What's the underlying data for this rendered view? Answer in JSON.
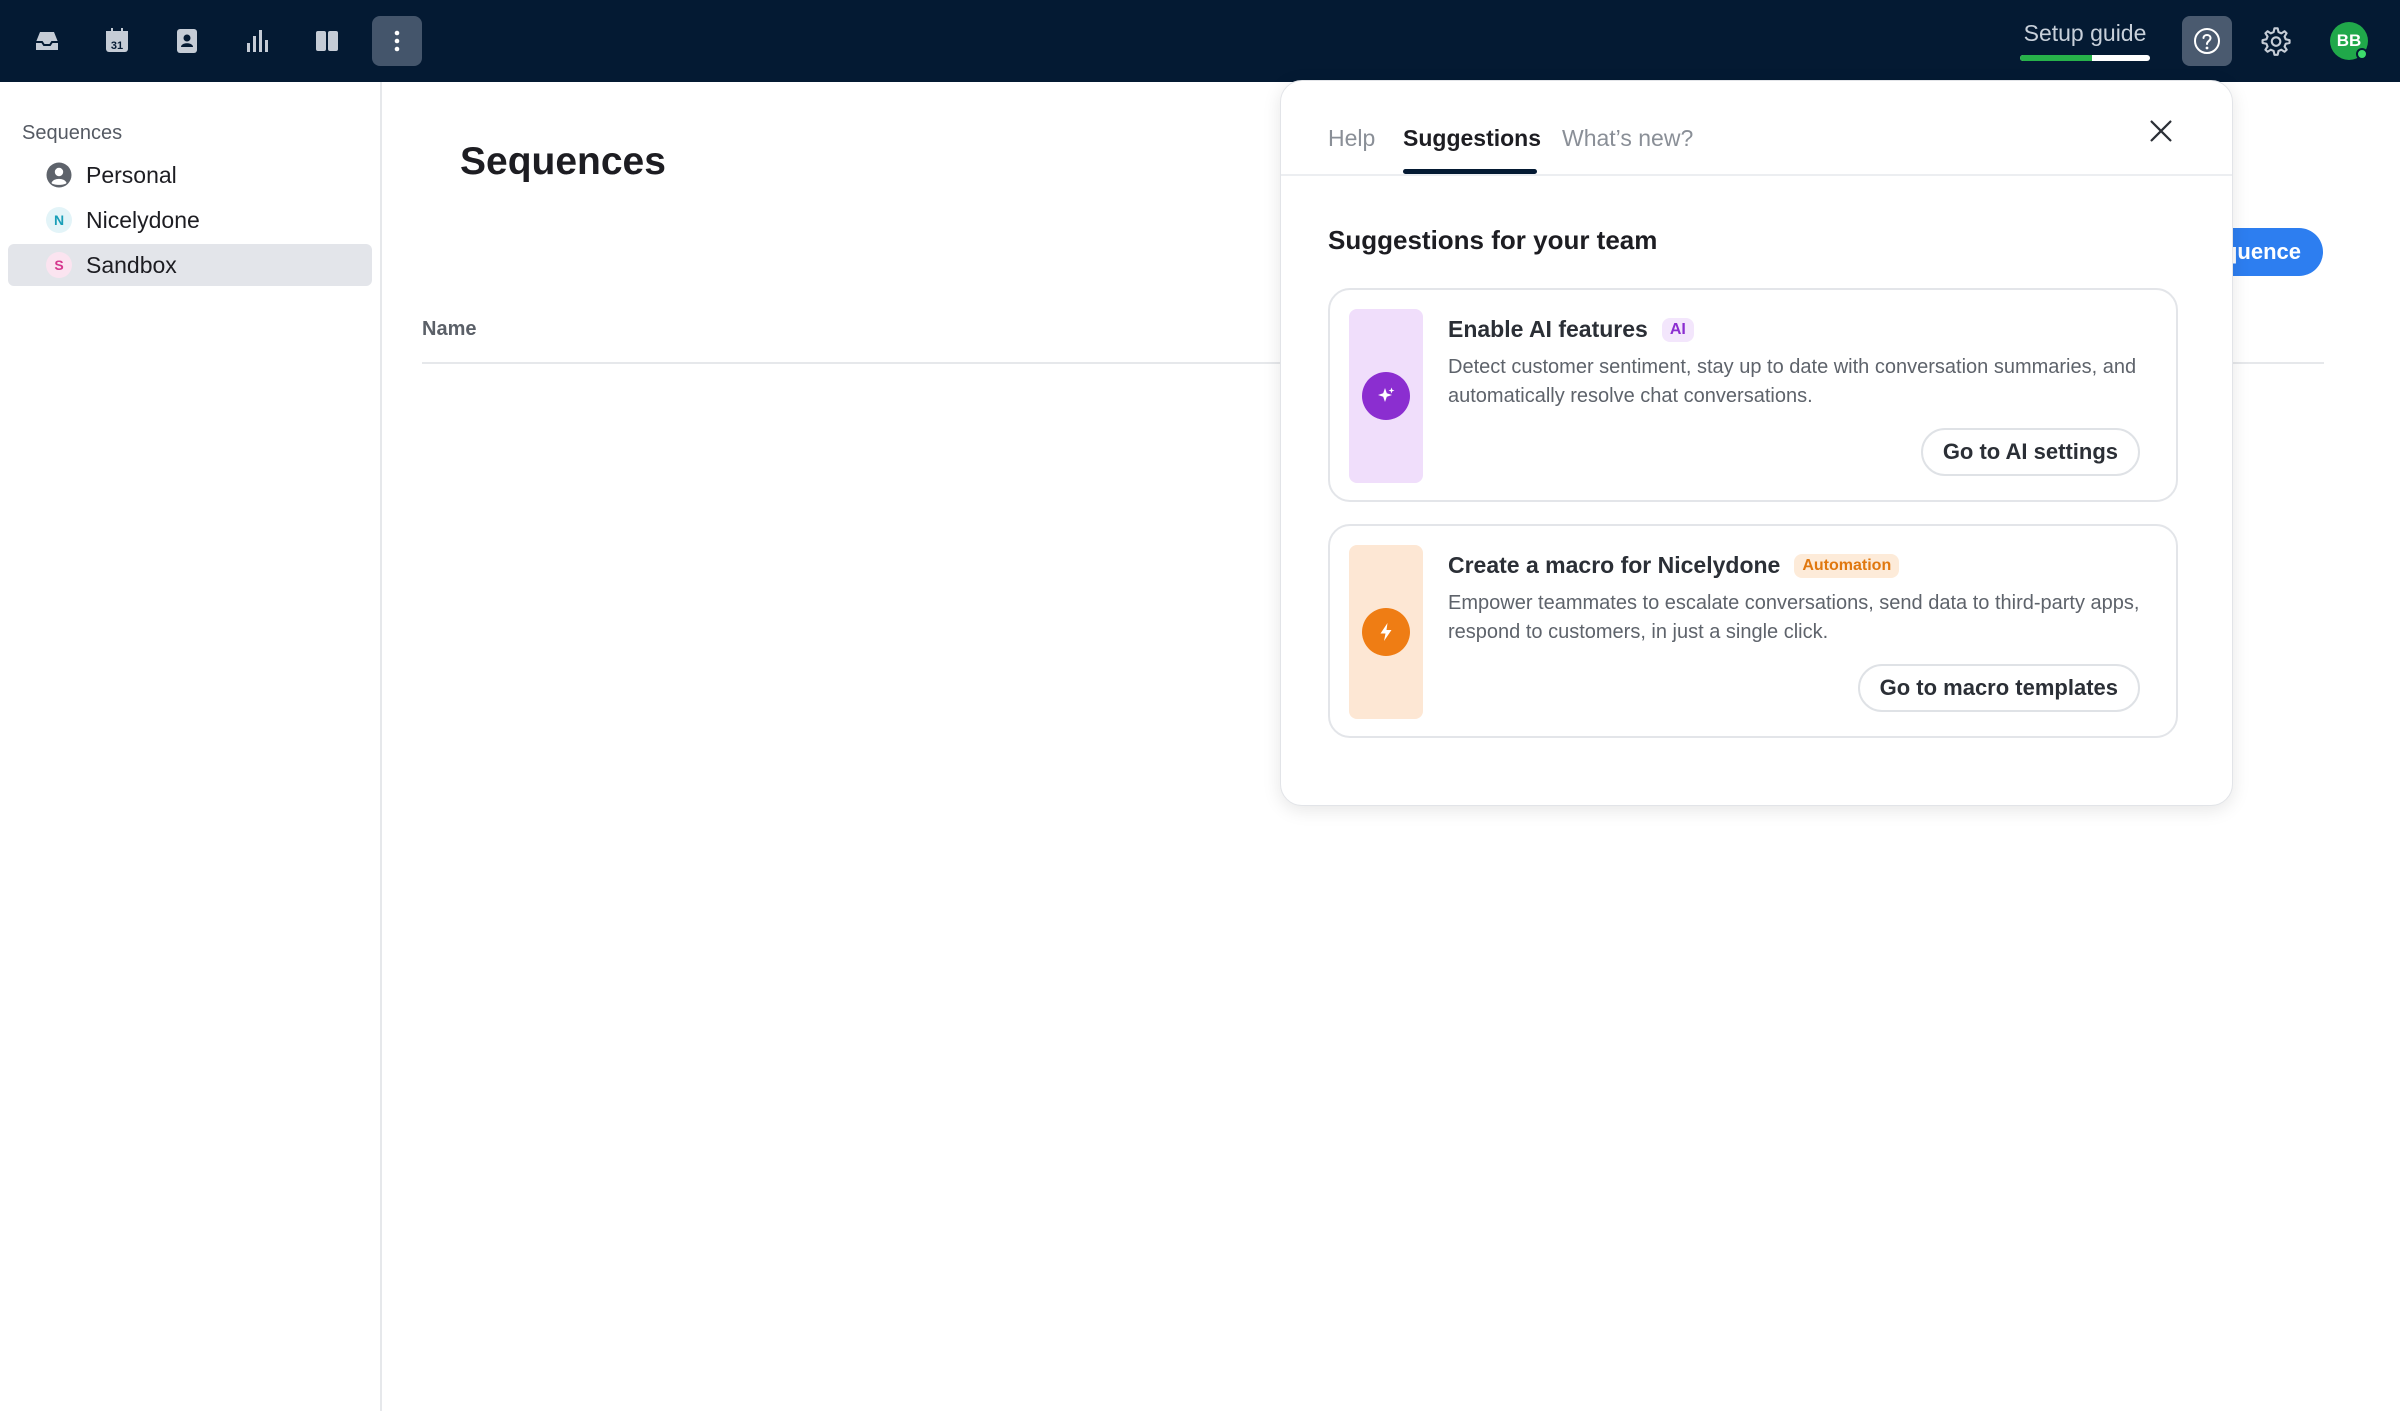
{
  "topbar": {
    "nav_icons": [
      "inbox-icon",
      "calendar-icon",
      "contacts-icon",
      "reports-icon",
      "knowledge-base-icon",
      "more-icon"
    ],
    "calendar_day": "31",
    "setup_guide": {
      "label": "Setup guide",
      "progress": 0.55
    },
    "avatar_initials": "BB",
    "accent_colors": {
      "bar": "#041a33",
      "progress": "#27b24a",
      "presence": "#3ddc6b"
    }
  },
  "sidebar": {
    "heading": "Sequences",
    "items": [
      {
        "label": "Personal",
        "icon": "person-icon",
        "selected": false
      },
      {
        "label": "Nicelydone",
        "initial": "N",
        "color": "#1a9fb8",
        "selected": false
      },
      {
        "label": "Sandbox",
        "initial": "S",
        "color": "#d6358d",
        "selected": true
      }
    ]
  },
  "main": {
    "title": "Sequences",
    "column_name": "Name",
    "new_button_label": "New sequence",
    "new_button_visible_text": "quence"
  },
  "help_panel": {
    "tabs": [
      {
        "label": "Help",
        "active": false
      },
      {
        "label": "Suggestions",
        "active": true
      },
      {
        "label": "What’s new?",
        "active": false
      }
    ],
    "heading": "Suggestions for your team",
    "cards": [
      {
        "title": "Enable AI features",
        "badge": "AI",
        "description": "Detect customer sentiment, stay up to date with conversation summaries, and automatically resolve chat conversations.",
        "button": "Go to AI settings",
        "icon": "sparkle-icon",
        "strip_color": "#f0defb",
        "icon_color": "#8b2ed0",
        "badge_bg": "#f3e6fc",
        "badge_fg": "#8b2ed0"
      },
      {
        "title": "Create a macro for Nicelydone",
        "badge": "Automation",
        "description": "Empower teammates to escalate conversations, send data to third-party apps, respond to customers, in just a single click.",
        "button": "Go to macro templates",
        "icon": "lightning-icon",
        "strip_color": "#fde7d4",
        "icon_color": "#ef7d14",
        "badge_bg": "#fdebd9",
        "badge_fg": "#e07810"
      }
    ]
  }
}
